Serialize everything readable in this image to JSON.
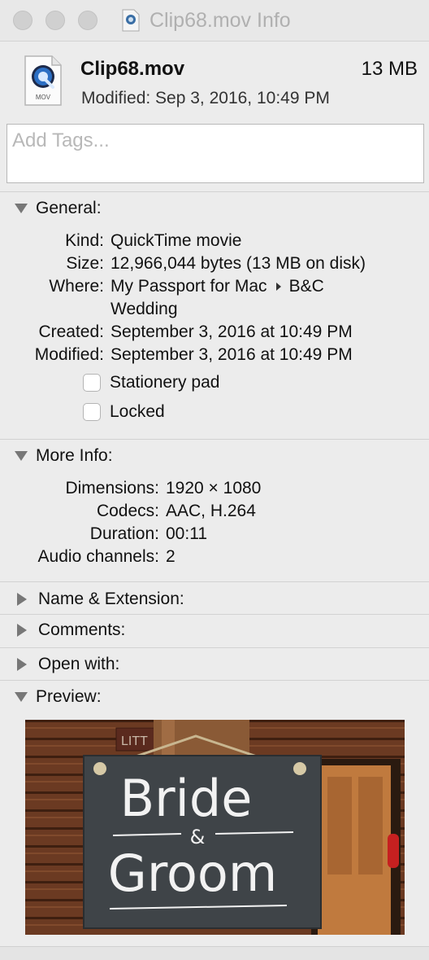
{
  "window": {
    "title": "Clip68.mov Info"
  },
  "file": {
    "name": "Clip68.mov",
    "size": "13 MB",
    "modified": "Modified: Sep 3, 2016, 10:49 PM",
    "icon": "quicktime-mov-icon",
    "icon_label": "MOV"
  },
  "tags": {
    "placeholder": "Add Tags..."
  },
  "general": {
    "header": "General:",
    "kind_label": "Kind:",
    "kind": "QuickTime movie",
    "size_label": "Size:",
    "size": "12,966,044 bytes (13 MB on disk)",
    "where_label": "Where:",
    "where_1": "My Passport for Mac",
    "where_2": "B&C",
    "where_3": "Wedding",
    "created_label": "Created:",
    "created": "September 3, 2016 at 10:49 PM",
    "modified_label": "Modified:",
    "modified": "September 3, 2016 at 10:49 PM",
    "stationery_label": "Stationery pad",
    "stationery_checked": false,
    "locked_label": "Locked",
    "locked_checked": false
  },
  "more_info": {
    "header": "More Info:",
    "dimensions_label": "Dimensions:",
    "dimensions": "1920 × 1080",
    "codecs_label": "Codecs:",
    "codecs": "AAC, H.264",
    "duration_label": "Duration:",
    "duration": "00:11",
    "audio_label": "Audio channels:",
    "audio": "2"
  },
  "sections": {
    "name_ext": "Name & Extension:",
    "comments": "Comments:",
    "open_with": "Open with:",
    "preview": "Preview:"
  },
  "preview_image": {
    "sign_line1": "Bride",
    "sign_amp": "&",
    "sign_line2": "Groom",
    "plaque_text": "LITT"
  },
  "colors": {
    "window_bg": "#ececec",
    "traffic_light": "#d0d0d0",
    "title_text": "#b0b0b0",
    "disclosure": "#777777"
  }
}
